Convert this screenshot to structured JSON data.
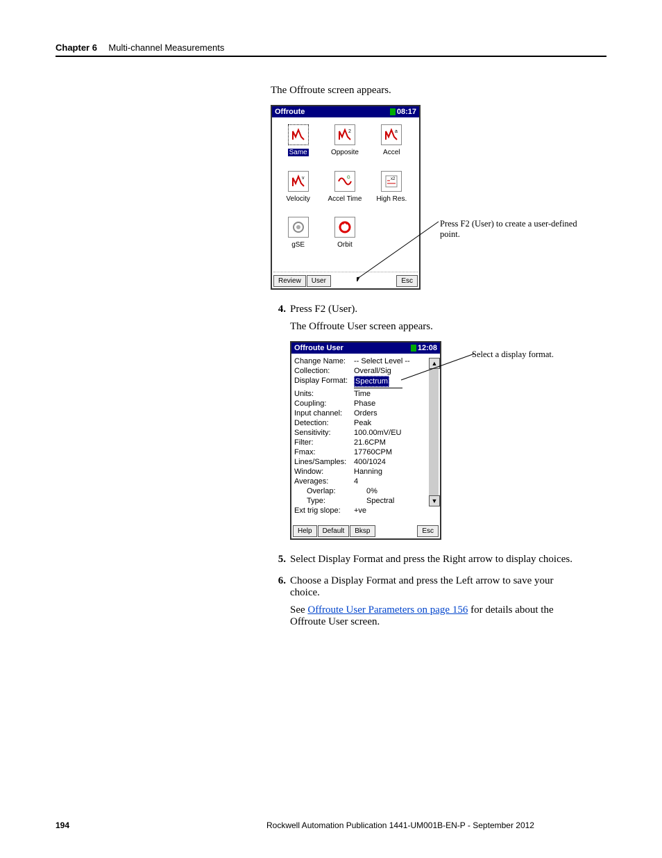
{
  "header": {
    "chapter_label": "Chapter 6",
    "chapter_title": "Multi-channel Measurements"
  },
  "intro1": "The Offroute screen appears.",
  "offroute_screen": {
    "title": "Offroute",
    "time": "08:17",
    "icons": [
      {
        "label": "Same",
        "selected": true
      },
      {
        "label": "Opposite"
      },
      {
        "label": "Accel"
      },
      {
        "label": "Velocity"
      },
      {
        "label": "Accel Time"
      },
      {
        "label": "High Res."
      },
      {
        "label": "gSE"
      },
      {
        "label": "Orbit"
      }
    ],
    "buttons": {
      "b1": "Review",
      "b2": "User",
      "b4": "Esc"
    }
  },
  "callout1": "Press F2 (User) to create a user-defined point.",
  "step4": {
    "num": "4.",
    "text": "Press F2 (User)."
  },
  "intro2": "The Offroute User screen appears.",
  "offroute_user_screen": {
    "title": "Offroute User",
    "time": "12:08",
    "params": [
      {
        "label": "Change Name:",
        "value": "-- Select Level --"
      },
      {
        "label": "Collection:",
        "value": "Overall/Sig"
      },
      {
        "label": "Display Format:",
        "value": "Spectrum",
        "selected": true
      },
      {
        "label": "Units:",
        "value": "Time",
        "dropdown": true
      },
      {
        "label": "Coupling:",
        "value": "Phase",
        "dropdown": true
      },
      {
        "label": "Input channel:",
        "value": "Orders",
        "dropdown": true
      },
      {
        "label": "Detection:",
        "value": "Peak"
      },
      {
        "label": "Sensitivity:",
        "value": "100.00mV/EU"
      },
      {
        "label": "Filter:",
        "value": "21.6CPM"
      },
      {
        "label": "Fmax:",
        "value": "17760CPM"
      },
      {
        "label": "Lines/Samples:",
        "value": "400/1024"
      },
      {
        "label": "Window:",
        "value": "Hanning"
      },
      {
        "label": "Averages:",
        "value": "4"
      },
      {
        "label": "    Overlap:",
        "value": "0%"
      },
      {
        "label": "    Type:",
        "value": "Spectral"
      },
      {
        "label": "Ext trig slope:",
        "value": "+ve"
      }
    ],
    "buttons": {
      "b1": "Help",
      "b2": "Default",
      "b3": "Bksp",
      "b4": "Esc"
    }
  },
  "callout2": "Select a display format.",
  "step5": {
    "num": "5.",
    "text": "Select Display Format and press the Right arrow to display choices."
  },
  "step6": {
    "num": "6.",
    "text_pre": "Choose a Display Format and press the Left arrow to save your choice.",
    "text_see": "See ",
    "link": "Offroute User Parameters on page 156",
    "text_post": " for details about the Offroute User screen."
  },
  "footer": {
    "page_num": "194",
    "pub": "Rockwell Automation Publication 1441-UM001B-EN-P - September 2012"
  }
}
